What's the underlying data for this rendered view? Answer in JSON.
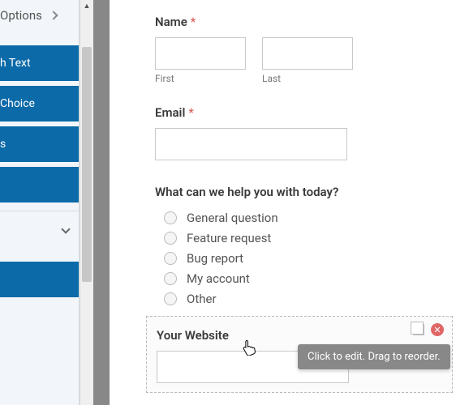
{
  "sidebar": {
    "options_label": "Options",
    "items": [
      "h Text",
      "Choice",
      "s",
      "",
      ""
    ]
  },
  "form": {
    "name": {
      "label": "Name",
      "first_label": "First",
      "last_label": "Last"
    },
    "email": {
      "label": "Email"
    },
    "help": {
      "label": "What can we help you with today?",
      "options": [
        "General question",
        "Feature request",
        "Bug report",
        "My account",
        "Other"
      ]
    },
    "website": {
      "label": "Your Website"
    }
  },
  "tooltip": "Click to edit. Drag to reorder."
}
